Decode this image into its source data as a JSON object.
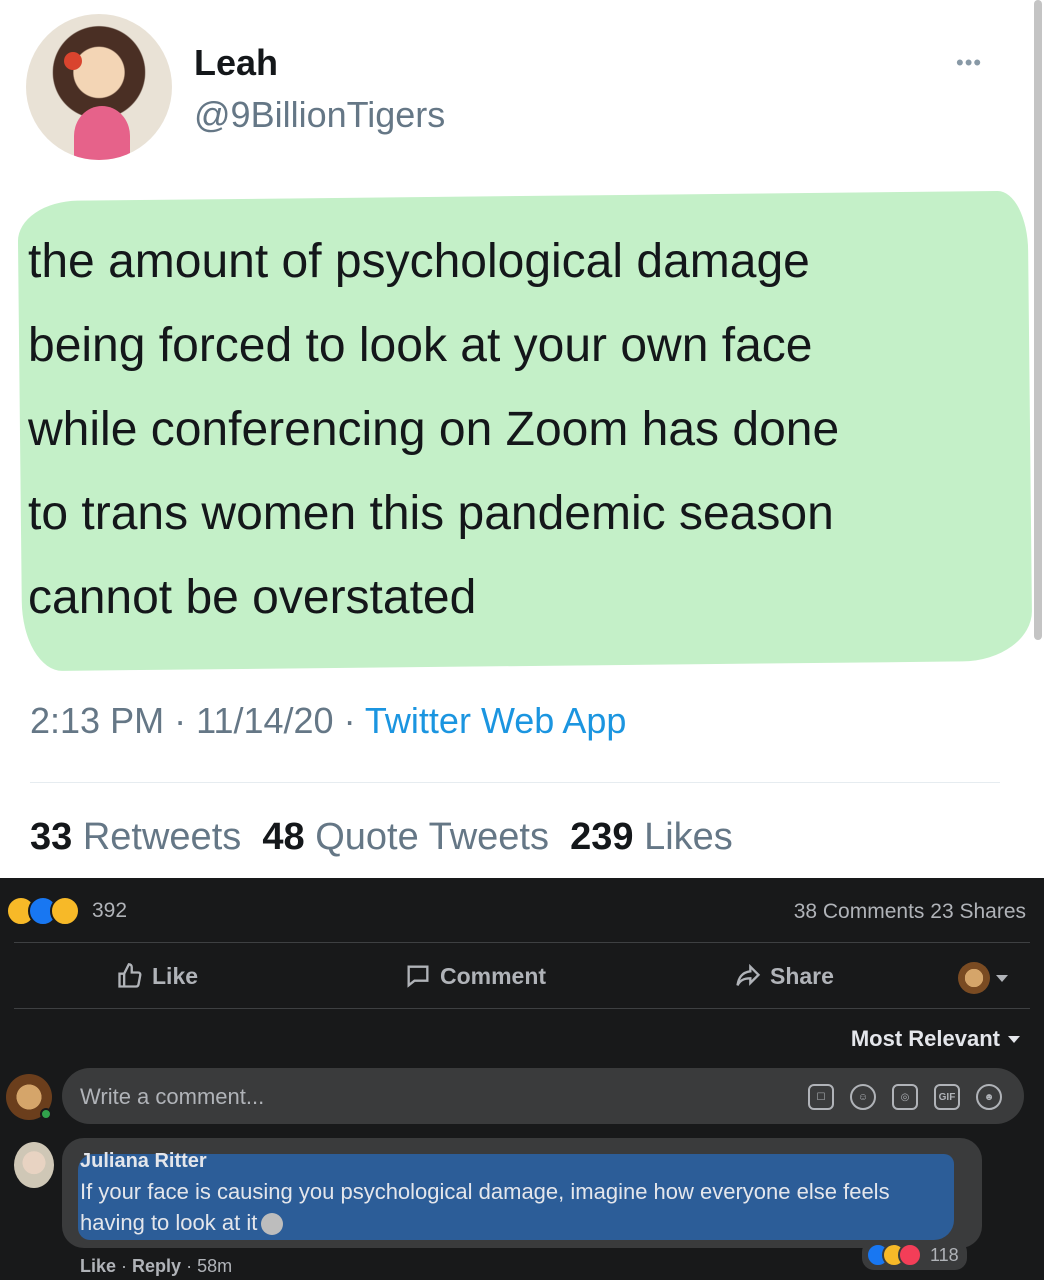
{
  "tweet": {
    "name": "Leah",
    "handle": "@9BillionTigers",
    "more_icon": "more-options-icon",
    "text_lines": [
      "the amount of psychological damage",
      "being forced to look at your own face",
      "while conferencing on Zoom has done",
      "to trans women this pandemic season",
      "cannot be overstated"
    ],
    "time": "2:13 PM",
    "date": "11/14/20",
    "source": "Twitter Web App",
    "retweets_count": "33",
    "retweets_label": "Retweets",
    "quote_count": "48",
    "quote_label": "Quote Tweets",
    "likes_count": "239",
    "likes_label": "Likes",
    "highlight_color": "#c4f0c8"
  },
  "facebook": {
    "reaction_count": "392",
    "comments": "38 Comments",
    "shares": "23 Shares",
    "like_label": "Like",
    "comment_label": "Comment",
    "share_label": "Share",
    "sort_label": "Most Relevant",
    "input_placeholder": "Write a comment...",
    "input_icons": [
      "sticker-icon",
      "emoji-icon",
      "camera-icon",
      "gif-icon",
      "sticker-face-icon"
    ],
    "comment": {
      "author": "Juliana Ritter",
      "text": "If your face is causing you psychological damage, imagine how everyone else feels having to look at it",
      "reaction_count": "118",
      "like": "Like",
      "reply": "Reply",
      "age": "58m"
    },
    "bg_color": "#18191a",
    "highlight_color": "#2c5d98"
  }
}
